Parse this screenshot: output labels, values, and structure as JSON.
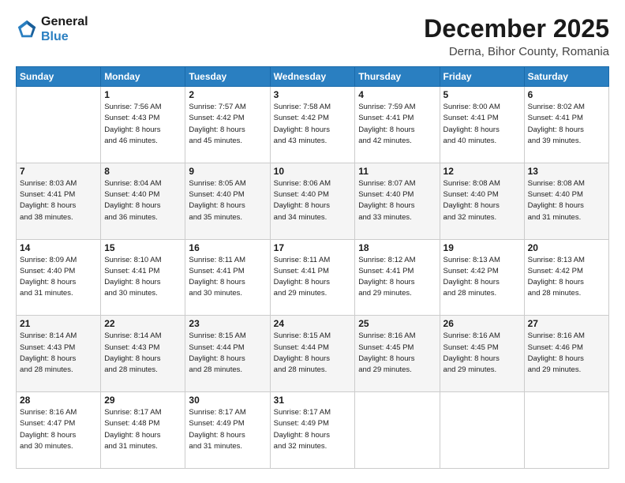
{
  "header": {
    "logo_line1": "General",
    "logo_line2": "Blue",
    "title": "December 2025",
    "subtitle": "Derna, Bihor County, Romania"
  },
  "weekdays": [
    "Sunday",
    "Monday",
    "Tuesday",
    "Wednesday",
    "Thursday",
    "Friday",
    "Saturday"
  ],
  "weeks": [
    [
      {
        "day": "",
        "info": ""
      },
      {
        "day": "1",
        "info": "Sunrise: 7:56 AM\nSunset: 4:43 PM\nDaylight: 8 hours\nand 46 minutes."
      },
      {
        "day": "2",
        "info": "Sunrise: 7:57 AM\nSunset: 4:42 PM\nDaylight: 8 hours\nand 45 minutes."
      },
      {
        "day": "3",
        "info": "Sunrise: 7:58 AM\nSunset: 4:42 PM\nDaylight: 8 hours\nand 43 minutes."
      },
      {
        "day": "4",
        "info": "Sunrise: 7:59 AM\nSunset: 4:41 PM\nDaylight: 8 hours\nand 42 minutes."
      },
      {
        "day": "5",
        "info": "Sunrise: 8:00 AM\nSunset: 4:41 PM\nDaylight: 8 hours\nand 40 minutes."
      },
      {
        "day": "6",
        "info": "Sunrise: 8:02 AM\nSunset: 4:41 PM\nDaylight: 8 hours\nand 39 minutes."
      }
    ],
    [
      {
        "day": "7",
        "info": "Sunrise: 8:03 AM\nSunset: 4:41 PM\nDaylight: 8 hours\nand 38 minutes."
      },
      {
        "day": "8",
        "info": "Sunrise: 8:04 AM\nSunset: 4:40 PM\nDaylight: 8 hours\nand 36 minutes."
      },
      {
        "day": "9",
        "info": "Sunrise: 8:05 AM\nSunset: 4:40 PM\nDaylight: 8 hours\nand 35 minutes."
      },
      {
        "day": "10",
        "info": "Sunrise: 8:06 AM\nSunset: 4:40 PM\nDaylight: 8 hours\nand 34 minutes."
      },
      {
        "day": "11",
        "info": "Sunrise: 8:07 AM\nSunset: 4:40 PM\nDaylight: 8 hours\nand 33 minutes."
      },
      {
        "day": "12",
        "info": "Sunrise: 8:08 AM\nSunset: 4:40 PM\nDaylight: 8 hours\nand 32 minutes."
      },
      {
        "day": "13",
        "info": "Sunrise: 8:08 AM\nSunset: 4:40 PM\nDaylight: 8 hours\nand 31 minutes."
      }
    ],
    [
      {
        "day": "14",
        "info": "Sunrise: 8:09 AM\nSunset: 4:40 PM\nDaylight: 8 hours\nand 31 minutes."
      },
      {
        "day": "15",
        "info": "Sunrise: 8:10 AM\nSunset: 4:41 PM\nDaylight: 8 hours\nand 30 minutes."
      },
      {
        "day": "16",
        "info": "Sunrise: 8:11 AM\nSunset: 4:41 PM\nDaylight: 8 hours\nand 30 minutes."
      },
      {
        "day": "17",
        "info": "Sunrise: 8:11 AM\nSunset: 4:41 PM\nDaylight: 8 hours\nand 29 minutes."
      },
      {
        "day": "18",
        "info": "Sunrise: 8:12 AM\nSunset: 4:41 PM\nDaylight: 8 hours\nand 29 minutes."
      },
      {
        "day": "19",
        "info": "Sunrise: 8:13 AM\nSunset: 4:42 PM\nDaylight: 8 hours\nand 28 minutes."
      },
      {
        "day": "20",
        "info": "Sunrise: 8:13 AM\nSunset: 4:42 PM\nDaylight: 8 hours\nand 28 minutes."
      }
    ],
    [
      {
        "day": "21",
        "info": "Sunrise: 8:14 AM\nSunset: 4:43 PM\nDaylight: 8 hours\nand 28 minutes."
      },
      {
        "day": "22",
        "info": "Sunrise: 8:14 AM\nSunset: 4:43 PM\nDaylight: 8 hours\nand 28 minutes."
      },
      {
        "day": "23",
        "info": "Sunrise: 8:15 AM\nSunset: 4:44 PM\nDaylight: 8 hours\nand 28 minutes."
      },
      {
        "day": "24",
        "info": "Sunrise: 8:15 AM\nSunset: 4:44 PM\nDaylight: 8 hours\nand 28 minutes."
      },
      {
        "day": "25",
        "info": "Sunrise: 8:16 AM\nSunset: 4:45 PM\nDaylight: 8 hours\nand 29 minutes."
      },
      {
        "day": "26",
        "info": "Sunrise: 8:16 AM\nSunset: 4:45 PM\nDaylight: 8 hours\nand 29 minutes."
      },
      {
        "day": "27",
        "info": "Sunrise: 8:16 AM\nSunset: 4:46 PM\nDaylight: 8 hours\nand 29 minutes."
      }
    ],
    [
      {
        "day": "28",
        "info": "Sunrise: 8:16 AM\nSunset: 4:47 PM\nDaylight: 8 hours\nand 30 minutes."
      },
      {
        "day": "29",
        "info": "Sunrise: 8:17 AM\nSunset: 4:48 PM\nDaylight: 8 hours\nand 31 minutes."
      },
      {
        "day": "30",
        "info": "Sunrise: 8:17 AM\nSunset: 4:49 PM\nDaylight: 8 hours\nand 31 minutes."
      },
      {
        "day": "31",
        "info": "Sunrise: 8:17 AM\nSunset: 4:49 PM\nDaylight: 8 hours\nand 32 minutes."
      },
      {
        "day": "",
        "info": ""
      },
      {
        "day": "",
        "info": ""
      },
      {
        "day": "",
        "info": ""
      }
    ]
  ]
}
